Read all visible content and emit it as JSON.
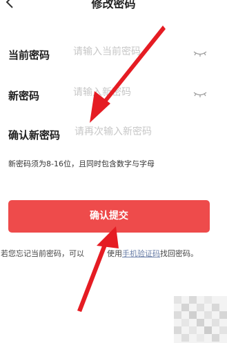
{
  "header": {
    "title": "修改密码"
  },
  "form": {
    "current_label": "当前密码",
    "current_placeholder": "请输入当前密码",
    "new_label": "新密码",
    "new_placeholder": "请输入新密码",
    "confirm_label": "确认新密码",
    "confirm_placeholder": "请再次输入新密码"
  },
  "hint": "新密码须为8-16位，且同时包含数字与字母",
  "submit_label": "确认提交",
  "forgot": {
    "prefix": "若您忘记当前密码，可以",
    "middle": "使用",
    "link": "手机验证码",
    "suffix": "找回密码。"
  },
  "colors": {
    "primary": "#ee4b4b",
    "link": "#6b7fa8",
    "annotation_arrow": "#e51c23"
  },
  "icons": [
    "back-arrow-icon",
    "eye-closed-icon"
  ]
}
